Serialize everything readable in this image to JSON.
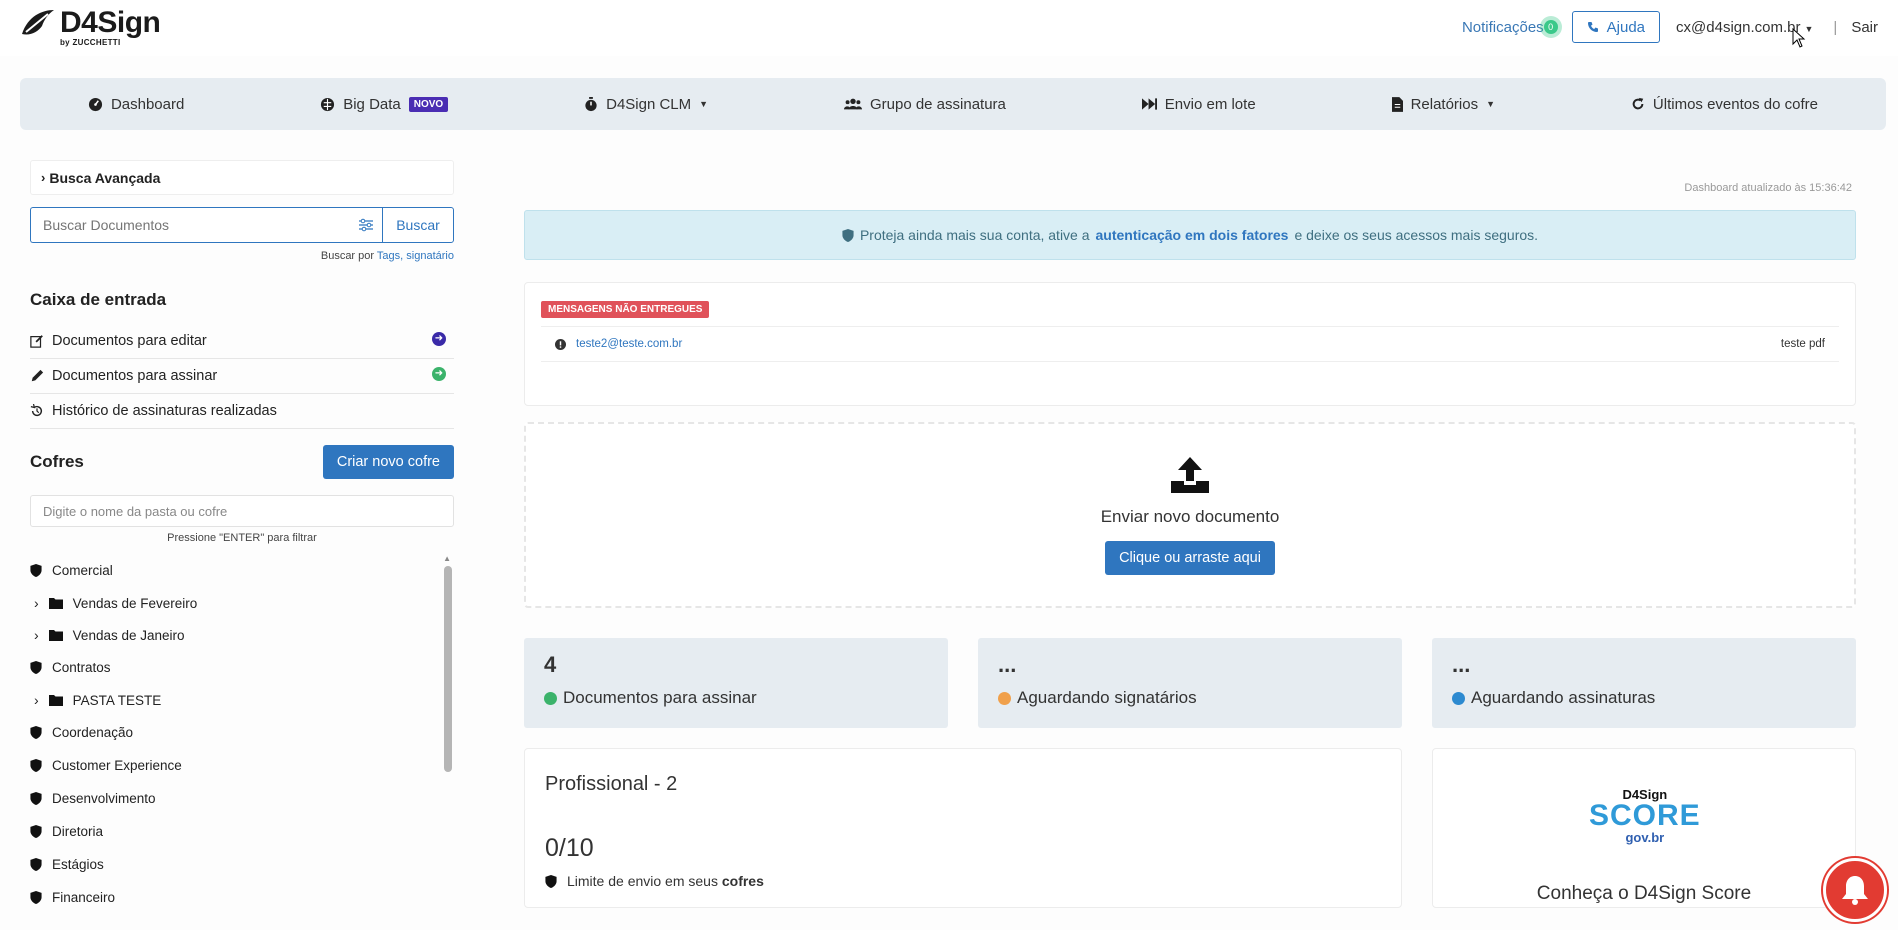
{
  "header": {
    "logo_word": "D4Sign",
    "logo_by": "by ZUCCHETTI",
    "notifications_label": "Notificações",
    "notifications_count": "0",
    "help_label": "Ajuda",
    "user_email": "cx@d4sign.com.br",
    "separator": "|",
    "logout_label": "Sair"
  },
  "nav": {
    "items": [
      {
        "label": "Dashboard",
        "icon": "dashboard-icon"
      },
      {
        "label": "Big Data",
        "icon": "brain-icon",
        "badge": "NOVO"
      },
      {
        "label": "D4Sign CLM",
        "icon": "stopwatch-icon",
        "dropdown": true
      },
      {
        "label": "Grupo de assinatura",
        "icon": "users-icon"
      },
      {
        "label": "Envio em lote",
        "icon": "fast-forward-icon"
      },
      {
        "label": "Relatórios",
        "icon": "file-icon",
        "dropdown": true
      },
      {
        "label": "Últimos eventos do cofre",
        "icon": "refresh-icon"
      }
    ]
  },
  "sidebar": {
    "advanced_search": "Busca Avançada",
    "search_placeholder": "Buscar Documentos",
    "search_button": "Buscar",
    "search_by_prefix": "Buscar por",
    "search_by_tags": "Tags",
    "search_by_comma": ",",
    "search_by_signatario": "signatário",
    "inbox_title": "Caixa de entrada",
    "inbox_items": [
      {
        "label": "Documentos para editar",
        "icon": "edit-icon"
      },
      {
        "label": "Documentos para assinar",
        "icon": "pencil-icon"
      },
      {
        "label": "Histórico de assinaturas realizadas",
        "icon": "history-icon"
      }
    ],
    "cofres_title": "Cofres",
    "create_cofre_button": "Criar novo cofre",
    "filter_placeholder": "Digite o nome da pasta ou cofre",
    "filter_hint": "Pressione \"ENTER\" para filtrar",
    "tree": [
      {
        "label": "Comercial",
        "type": "cofre"
      },
      {
        "label": "Vendas de Fevereiro",
        "type": "folder"
      },
      {
        "label": "Vendas de Janeiro",
        "type": "folder"
      },
      {
        "label": "Contratos",
        "type": "cofre"
      },
      {
        "label": "PASTA TESTE",
        "type": "folder"
      },
      {
        "label": "Coordenação",
        "type": "cofre"
      },
      {
        "label": "Customer Experience",
        "type": "cofre"
      },
      {
        "label": "Desenvolvimento",
        "type": "cofre"
      },
      {
        "label": "Diretoria",
        "type": "cofre"
      },
      {
        "label": "Estágios",
        "type": "cofre"
      },
      {
        "label": "Financeiro",
        "type": "cofre"
      }
    ]
  },
  "main": {
    "updated_text": "Dashboard atualizado às 15:36:42",
    "alert_prefix": "Proteja ainda mais sua conta, ative a",
    "alert_link": "autenticação em dois fatores",
    "alert_suffix": "e deixe os seus acessos mais seguros.",
    "undelivered_label": "MENSAGENS NÃO ENTREGUES",
    "undelivered_email": "teste2@teste.com.br",
    "undelivered_doc": "teste pdf",
    "upload_title": "Enviar novo documento",
    "upload_button": "Clique ou arraste aqui",
    "stats": [
      {
        "value": "4",
        "label": "Documentos para assinar",
        "color": "#3bb36b"
      },
      {
        "value": "...",
        "label": "Aguardando signatários",
        "color": "#f0a04b"
      },
      {
        "value": "...",
        "label": "Aguardando assinaturas",
        "color": "#2d8ad0"
      }
    ],
    "plan_title": "Profissional - 2",
    "plan_count": "0/10",
    "plan_limit_prefix": "Limite de envio em seus",
    "plan_limit_bold": "cofres",
    "score_logo_brand": "D4Sign",
    "score_logo_word": "SCORE",
    "score_logo_gov": "gov.br",
    "score_title": "Conheça o D4Sign Score"
  },
  "colors": {
    "primary": "#2f76bf",
    "nav_bg": "#e6ecf1",
    "danger": "#e0525a",
    "badge_novo": "#4a2db3"
  }
}
